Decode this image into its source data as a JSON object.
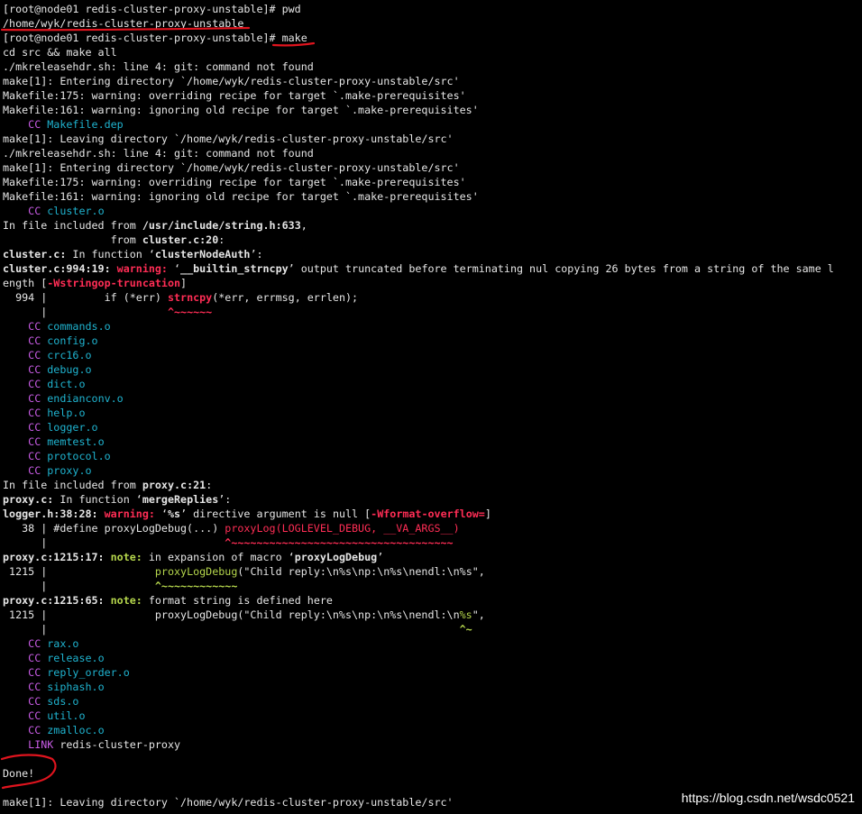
{
  "theme": {
    "background": "#000000",
    "default": "#e6e6e6",
    "target": "#1fb3cf",
    "tool": "#c95ce6",
    "warning": "#ff2d55",
    "note": "#b5d64c",
    "annotation": "#e0141e"
  },
  "terminal": {
    "lines": [
      [
        {
          "t": "[root@node01 redis-cluster-proxy-unstable]# pwd",
          "c": "w"
        }
      ],
      [
        {
          "t": "/home/wyk/redis-cluster-proxy-unstable",
          "c": "w"
        }
      ],
      [
        {
          "t": "[root@node01 redis-cluster-proxy-unstable]# make",
          "c": "w"
        }
      ],
      [
        {
          "t": "cd src && make all",
          "c": "w"
        }
      ],
      [
        {
          "t": "./mkreleasehdr.sh: line 4: git: command not found",
          "c": "w"
        }
      ],
      [
        {
          "t": "make[1]: Entering directory `/home/wyk/redis-cluster-proxy-unstable/src'",
          "c": "w"
        }
      ],
      [
        {
          "t": "Makefile:175: warning: overriding recipe for target `.make-prerequisites'",
          "c": "w"
        }
      ],
      [
        {
          "t": "Makefile:161: warning: ignoring old recipe for target `.make-prerequisites'",
          "c": "w"
        }
      ],
      [
        {
          "t": "    ",
          "c": "w"
        },
        {
          "t": "CC",
          "c": "mg"
        },
        {
          "t": " Makefile.dep",
          "c": "cy"
        }
      ],
      [
        {
          "t": "make[1]: Leaving directory `/home/wyk/redis-cluster-proxy-unstable/src'",
          "c": "w"
        }
      ],
      [
        {
          "t": "./mkreleasehdr.sh: line 4: git: command not found",
          "c": "w"
        }
      ],
      [
        {
          "t": "make[1]: Entering directory `/home/wyk/redis-cluster-proxy-unstable/src'",
          "c": "w"
        }
      ],
      [
        {
          "t": "Makefile:175: warning: overriding recipe for target `.make-prerequisites'",
          "c": "w"
        }
      ],
      [
        {
          "t": "Makefile:161: warning: ignoring old recipe for target `.make-prerequisites'",
          "c": "w"
        }
      ],
      [
        {
          "t": "    ",
          "c": "w"
        },
        {
          "t": "CC",
          "c": "mg"
        },
        {
          "t": " cluster.o",
          "c": "cy"
        }
      ],
      [
        {
          "t": "In file included from ",
          "c": "w"
        },
        {
          "t": "/usr/include/string.h:633",
          "c": "w b"
        },
        {
          "t": ",",
          "c": "w"
        }
      ],
      [
        {
          "t": "                 from ",
          "c": "w"
        },
        {
          "t": "cluster.c:20",
          "c": "w b"
        },
        {
          "t": ":",
          "c": "w"
        }
      ],
      [
        {
          "t": "cluster.c:",
          "c": "w b"
        },
        {
          "t": " In function ‘",
          "c": "w"
        },
        {
          "t": "clusterNodeAuth",
          "c": "w b"
        },
        {
          "t": "’:",
          "c": "w"
        }
      ],
      [
        {
          "t": "cluster.c:994:19:",
          "c": "w b"
        },
        {
          "t": " ",
          "c": "w"
        },
        {
          "t": "warning:",
          "c": "rd b"
        },
        {
          "t": " ‘",
          "c": "w"
        },
        {
          "t": "__builtin_strncpy",
          "c": "w b"
        },
        {
          "t": "’ output truncated before terminating nul copying 26 bytes from a string of the same l",
          "c": "w"
        }
      ],
      [
        {
          "t": "ength [",
          "c": "w"
        },
        {
          "t": "-Wstringop-truncation",
          "c": "rd b"
        },
        {
          "t": "]",
          "c": "w"
        }
      ],
      [
        {
          "t": "  994 |         if (*err) ",
          "c": "w"
        },
        {
          "t": "strncpy",
          "c": "rd b"
        },
        {
          "t": "(*err, errmsg, errlen);",
          "c": "w"
        }
      ],
      [
        {
          "t": "      |                   ",
          "c": "w"
        },
        {
          "t": "^~~~~~~",
          "c": "rd b"
        }
      ],
      [
        {
          "t": "    ",
          "c": "w"
        },
        {
          "t": "CC",
          "c": "mg"
        },
        {
          "t": " commands.o",
          "c": "cy"
        }
      ],
      [
        {
          "t": "    ",
          "c": "w"
        },
        {
          "t": "CC",
          "c": "mg"
        },
        {
          "t": " config.o",
          "c": "cy"
        }
      ],
      [
        {
          "t": "    ",
          "c": "w"
        },
        {
          "t": "CC",
          "c": "mg"
        },
        {
          "t": " crc16.o",
          "c": "cy"
        }
      ],
      [
        {
          "t": "    ",
          "c": "w"
        },
        {
          "t": "CC",
          "c": "mg"
        },
        {
          "t": " debug.o",
          "c": "cy"
        }
      ],
      [
        {
          "t": "    ",
          "c": "w"
        },
        {
          "t": "CC",
          "c": "mg"
        },
        {
          "t": " dict.o",
          "c": "cy"
        }
      ],
      [
        {
          "t": "    ",
          "c": "w"
        },
        {
          "t": "CC",
          "c": "mg"
        },
        {
          "t": " endianconv.o",
          "c": "cy"
        }
      ],
      [
        {
          "t": "    ",
          "c": "w"
        },
        {
          "t": "CC",
          "c": "mg"
        },
        {
          "t": " help.o",
          "c": "cy"
        }
      ],
      [
        {
          "t": "    ",
          "c": "w"
        },
        {
          "t": "CC",
          "c": "mg"
        },
        {
          "t": " logger.o",
          "c": "cy"
        }
      ],
      [
        {
          "t": "    ",
          "c": "w"
        },
        {
          "t": "CC",
          "c": "mg"
        },
        {
          "t": " memtest.o",
          "c": "cy"
        }
      ],
      [
        {
          "t": "    ",
          "c": "w"
        },
        {
          "t": "CC",
          "c": "mg"
        },
        {
          "t": " protocol.o",
          "c": "cy"
        }
      ],
      [
        {
          "t": "    ",
          "c": "w"
        },
        {
          "t": "CC",
          "c": "mg"
        },
        {
          "t": " proxy.o",
          "c": "cy"
        }
      ],
      [
        {
          "t": "In file included from ",
          "c": "w"
        },
        {
          "t": "proxy.c:21",
          "c": "w b"
        },
        {
          "t": ":",
          "c": "w"
        }
      ],
      [
        {
          "t": "proxy.c:",
          "c": "w b"
        },
        {
          "t": " In function ‘",
          "c": "w"
        },
        {
          "t": "mergeReplies",
          "c": "w b"
        },
        {
          "t": "’:",
          "c": "w"
        }
      ],
      [
        {
          "t": "logger.h:38:28:",
          "c": "w b"
        },
        {
          "t": " ",
          "c": "w"
        },
        {
          "t": "warning:",
          "c": "rd b"
        },
        {
          "t": " ‘",
          "c": "w"
        },
        {
          "t": "%s",
          "c": "w b"
        },
        {
          "t": "’ directive argument is null [",
          "c": "w"
        },
        {
          "t": "-Wformat-overflow=",
          "c": "rd b"
        },
        {
          "t": "]",
          "c": "w"
        }
      ],
      [
        {
          "t": "   38 | #define proxyLogDebug(...) ",
          "c": "w"
        },
        {
          "t": "proxyLog(LOGLEVEL_DEBUG, __VA_ARGS__)",
          "c": "rd"
        }
      ],
      [
        {
          "t": "      |                            ",
          "c": "w"
        },
        {
          "t": "^~~~~~~~~~~~~~~~~~~~~~~~~~~~~~~~~~~~",
          "c": "rd b"
        }
      ],
      [
        {
          "t": "proxy.c:1215:17:",
          "c": "w b"
        },
        {
          "t": " ",
          "c": "w"
        },
        {
          "t": "note:",
          "c": "gr b"
        },
        {
          "t": " in expansion of macro ‘",
          "c": "w"
        },
        {
          "t": "proxyLogDebug",
          "c": "w b"
        },
        {
          "t": "’",
          "c": "w"
        }
      ],
      [
        {
          "t": " 1215 |                 ",
          "c": "w"
        },
        {
          "t": "proxyLogDebug",
          "c": "gr"
        },
        {
          "t": "(\"Child reply:\\n%s\\np:\\n%s\\nendl:\\n%s\",",
          "c": "w"
        }
      ],
      [
        {
          "t": "      |                 ",
          "c": "w"
        },
        {
          "t": "^~~~~~~~~~~~~",
          "c": "gr b"
        }
      ],
      [
        {
          "t": "proxy.c:1215:65:",
          "c": "w b"
        },
        {
          "t": " ",
          "c": "w"
        },
        {
          "t": "note:",
          "c": "gr b"
        },
        {
          "t": " format string is defined here",
          "c": "w"
        }
      ],
      [
        {
          "t": " 1215 |                 proxyLogDebug(\"Child reply:\\n%s\\np:\\n%s\\nendl:\\n",
          "c": "w"
        },
        {
          "t": "%s",
          "c": "gr"
        },
        {
          "t": "\",",
          "c": "w"
        }
      ],
      [
        {
          "t": "      |                                                                 ",
          "c": "w"
        },
        {
          "t": "^~",
          "c": "gr b"
        }
      ],
      [
        {
          "t": "    ",
          "c": "w"
        },
        {
          "t": "CC",
          "c": "mg"
        },
        {
          "t": " rax.o",
          "c": "cy"
        }
      ],
      [
        {
          "t": "    ",
          "c": "w"
        },
        {
          "t": "CC",
          "c": "mg"
        },
        {
          "t": " release.o",
          "c": "cy"
        }
      ],
      [
        {
          "t": "    ",
          "c": "w"
        },
        {
          "t": "CC",
          "c": "mg"
        },
        {
          "t": " reply_order.o",
          "c": "cy"
        }
      ],
      [
        {
          "t": "    ",
          "c": "w"
        },
        {
          "t": "CC",
          "c": "mg"
        },
        {
          "t": " siphash.o",
          "c": "cy"
        }
      ],
      [
        {
          "t": "    ",
          "c": "w"
        },
        {
          "t": "CC",
          "c": "mg"
        },
        {
          "t": " sds.o",
          "c": "cy"
        }
      ],
      [
        {
          "t": "    ",
          "c": "w"
        },
        {
          "t": "CC",
          "c": "mg"
        },
        {
          "t": " util.o",
          "c": "cy"
        }
      ],
      [
        {
          "t": "    ",
          "c": "w"
        },
        {
          "t": "CC",
          "c": "mg"
        },
        {
          "t": " zmalloc.o",
          "c": "cy"
        }
      ],
      [
        {
          "t": "    ",
          "c": "w"
        },
        {
          "t": "LINK",
          "c": "mg"
        },
        {
          "t": " redis-cluster-proxy",
          "c": "w"
        }
      ],
      [
        {
          "t": "",
          "c": "w"
        }
      ],
      [
        {
          "t": "Done!",
          "c": "w"
        }
      ],
      [
        {
          "t": "",
          "c": "w"
        }
      ],
      [
        {
          "t": "make[1]: Leaving directory `/home/wyk/redis-cluster-proxy-unstable/src'",
          "c": "w"
        }
      ]
    ]
  },
  "annotations": [
    "pwd-output-underline",
    "make-command-underline",
    "done-circle"
  ],
  "watermark": "https://blog.csdn.net/wsdc0521"
}
